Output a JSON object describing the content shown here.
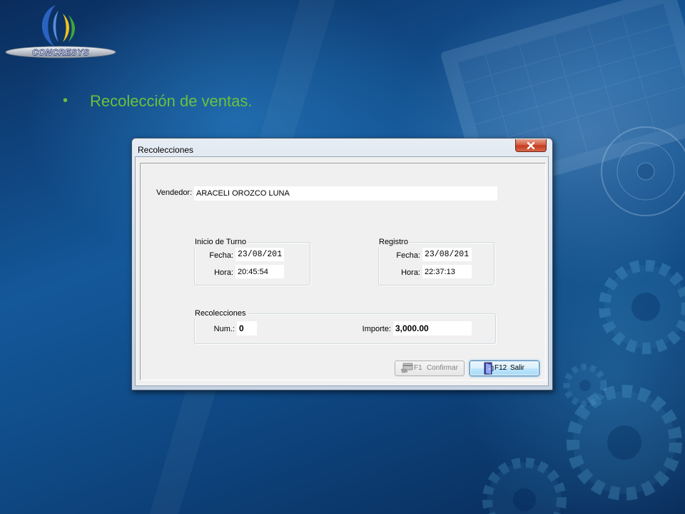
{
  "slide": {
    "logo_text": "CONCRESYS",
    "bullet": "•",
    "heading": "Recolección de ventas."
  },
  "window": {
    "title": "Recolecciones"
  },
  "form": {
    "vendedor": {
      "label": "Vendedor:",
      "value": "ARACELI OROZCO LUNA"
    },
    "inicio_turno": {
      "legend": "Inicio de Turno",
      "fecha_label": "Fecha:",
      "fecha_value": "23/08/201",
      "hora_label": "Hora:",
      "hora_value": "20:45:54"
    },
    "registro": {
      "legend": "Registro",
      "fecha_label": "Fecha:",
      "fecha_value": "23/08/201",
      "hora_label": "Hora:",
      "hora_value": "22:37:13"
    },
    "recolecciones": {
      "legend": "Recolecciones",
      "num_label": "Num.:",
      "num_value": "0",
      "importe_label": "Importe:",
      "importe_value": "3,000.00"
    }
  },
  "buttons": {
    "confirm": {
      "key": "F1",
      "label": "Confirmar",
      "enabled": false,
      "icon": "card-icon"
    },
    "exit": {
      "key": "F12",
      "label": "Salir",
      "focused": true,
      "icon": "exit-door-icon"
    }
  },
  "icons": {
    "close": "close-icon",
    "logo": "concresys-logo"
  },
  "colors": {
    "heading": "#6ac23c",
    "close_button": "#c8432b",
    "focus_border": "#3c7fb1",
    "dialog_background": "#f0f0f0",
    "field_background": "#ffffff"
  }
}
